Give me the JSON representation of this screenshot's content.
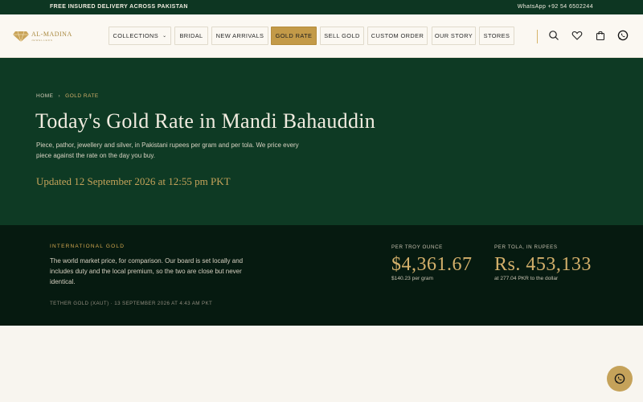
{
  "topbar": {
    "promo": "FREE INSURED DELIVERY ACROSS PAKISTAN",
    "whatsapp": "WhatsApp +92 54 6502244"
  },
  "brand": {
    "name": "AL-MADINA",
    "tagline": "JEWELLERS",
    "icon": "diamond-logo-icon"
  },
  "nav": {
    "items": [
      {
        "label": "COLLECTIONS",
        "dropdown": true
      },
      {
        "label": "BRIDAL"
      },
      {
        "label": "NEW ARRIVALS"
      },
      {
        "label": "GOLD RATE",
        "active": true
      },
      {
        "label": "SELL GOLD"
      },
      {
        "label": "CUSTOM ORDER"
      },
      {
        "label": "OUR STORY"
      },
      {
        "label": "STORES"
      }
    ],
    "icons": [
      "search-icon",
      "heart-icon",
      "cart-icon",
      "whatsapp-icon"
    ]
  },
  "hero": {
    "breadcrumb": {
      "home": "HOME",
      "current": "GOLD RATE"
    },
    "title": "Today's Gold Rate in Mandi Bahauddin",
    "description": "Piece, pathor, jewellery and silver, in Pakistani rupees per gram and per tola. We price every piece against the rate on the day you buy.",
    "updated": "Updated 12 September 2026 at 12:55 pm PKT"
  },
  "international": {
    "eyebrow": "INTERNATIONAL GOLD",
    "text": "The world market price, for comparison. Our board is set locally and includes duty and the local premium, so the two are close but never identical.",
    "source": "TETHER GOLD (XAUT) · 13 SEPTEMBER 2026 AT 4:43 AM PKT",
    "ounce": {
      "label": "PER TROY OUNCE",
      "value": "$4,361.67",
      "sub": "$140.23 per gram"
    },
    "tola": {
      "label": "PER TOLA, IN RUPEES",
      "value": "Rs. 453,133",
      "sub": "at 277.04 PKR to the dollar"
    }
  },
  "colors": {
    "dark_green": "#0e3a24",
    "deep_green": "#061a10",
    "gold": "#c39a48",
    "cream": "#f8f5ef"
  },
  "fab": {
    "icon": "whatsapp-icon"
  }
}
